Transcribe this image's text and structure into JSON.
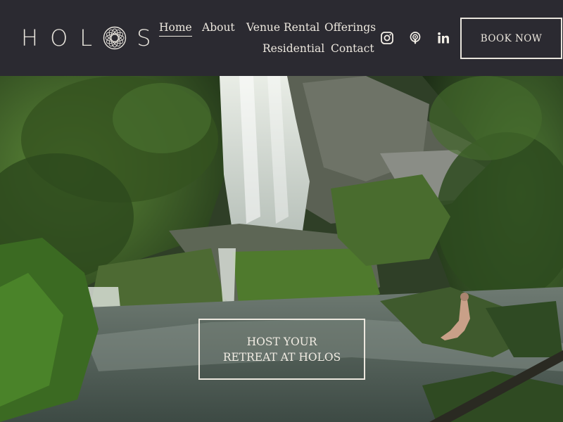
{
  "brand": {
    "logo_text_left": "HOL",
    "logo_text_right": "S"
  },
  "nav": {
    "items": [
      {
        "label": "Home",
        "active": true
      },
      {
        "label": "About"
      },
      {
        "label": "Venue Rental"
      },
      {
        "label": "Offerings"
      },
      {
        "label": "Residential"
      },
      {
        "label": "Contact"
      }
    ]
  },
  "social": {
    "icons": [
      "instagram-icon",
      "podcast-icon",
      "linkedin-icon"
    ]
  },
  "header": {
    "book_label": "BOOK NOW"
  },
  "hero": {
    "cta_line1": "HOST YOUR",
    "cta_line2": "RETREAT AT HOLOS"
  },
  "colors": {
    "header_bg": "#2b2a31",
    "text": "#ece7de"
  }
}
